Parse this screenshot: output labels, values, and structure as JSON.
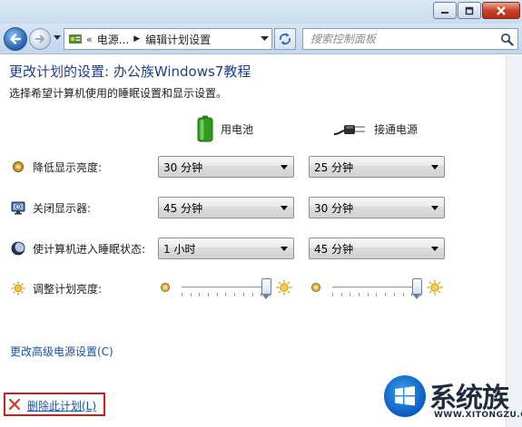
{
  "nav": {
    "breadcrumb_overflow": "«",
    "breadcrumbs": [
      "电源...",
      "编辑计划设置"
    ],
    "search_placeholder": "搜索控制面板"
  },
  "page": {
    "title": "更改计划的设置: 办公族Windows7教程",
    "subtitle": "选择希望计算机使用的睡眠设置和显示设置。"
  },
  "columns": {
    "battery": "用电池",
    "plugged_in": "接通电源"
  },
  "settings": [
    {
      "label": "降低显示亮度:",
      "battery": "30 分钟",
      "plugged_in": "25 分钟",
      "icon": "brightness-dim-icon"
    },
    {
      "label": "关闭显示器:",
      "battery": "45 分钟",
      "plugged_in": "30 分钟",
      "icon": "monitor-off-icon"
    },
    {
      "label": "使计算机进入睡眠状态:",
      "battery": "1 小时",
      "plugged_in": "45 分钟",
      "icon": "sleep-moon-icon"
    }
  ],
  "brightness": {
    "label": "调整计划亮度:",
    "battery_level_pct": 95,
    "plugged_in_level_pct": 95
  },
  "links": {
    "advanced": "更改高级电源设置(C)",
    "delete": "删除此计划(L)"
  },
  "watermark": {
    "text": "系统族",
    "url": "WWW.XITONGZU.COM"
  },
  "colors": {
    "title": "#1d3d8c",
    "link": "#1552a6",
    "highlight_border": "#d21a1a"
  }
}
